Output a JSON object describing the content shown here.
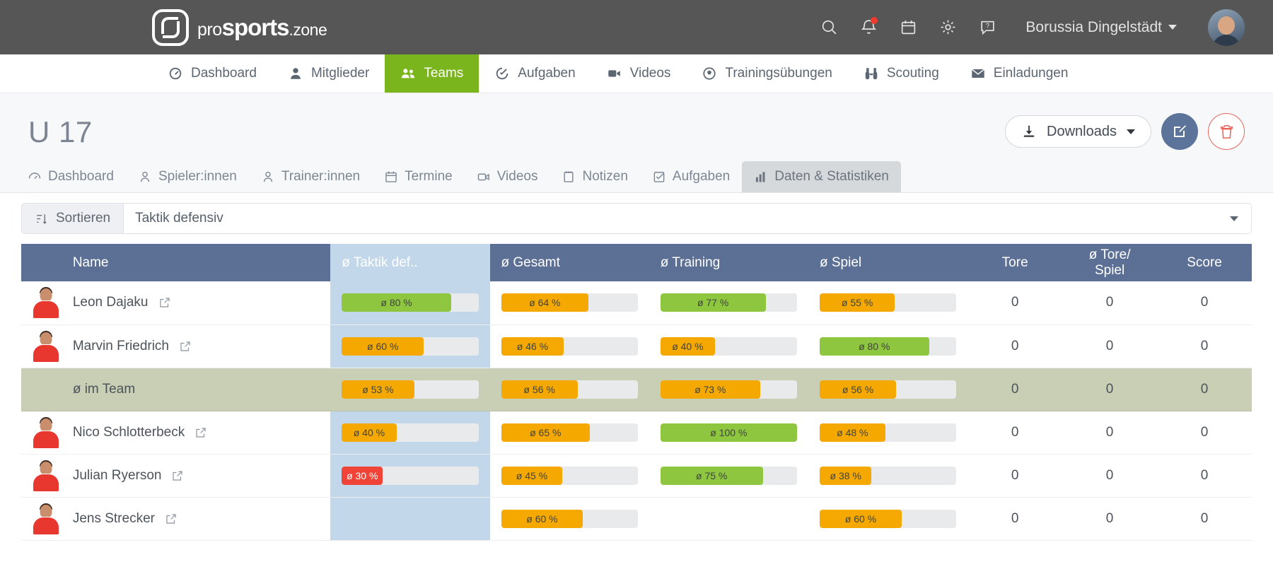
{
  "header": {
    "logo_pro": "pro",
    "logo_sports": "sports",
    "logo_zone": ".zone",
    "icons": [
      "search-icon",
      "bell-icon",
      "calendar-icon",
      "gear-icon",
      "help-icon"
    ],
    "org_name": "Borussia Dingelstädt"
  },
  "mainnav": [
    {
      "label": "Dashboard",
      "icon": "speedometer-icon",
      "active": false
    },
    {
      "label": "Mitglieder",
      "icon": "person-icon",
      "active": false
    },
    {
      "label": "Teams",
      "icon": "people-icon",
      "active": true
    },
    {
      "label": "Aufgaben",
      "icon": "check-circle-icon",
      "active": false
    },
    {
      "label": "Videos",
      "icon": "video-camera-icon",
      "active": false
    },
    {
      "label": "Trainingsübungen",
      "icon": "soccer-ball-icon",
      "active": false
    },
    {
      "label": "Scouting",
      "icon": "binoculars-icon",
      "active": false
    },
    {
      "label": "Einladungen",
      "icon": "envelope-icon",
      "active": false
    }
  ],
  "page": {
    "title": "U 17",
    "downloads_label": "Downloads",
    "edit_icon": "edit-pencil-icon",
    "delete_icon": "trash-icon"
  },
  "subtabs": [
    {
      "label": "Dashboard",
      "icon": "speedometer-icon",
      "active": false
    },
    {
      "label": "Spieler:innen",
      "icon": "person-icon",
      "active": false
    },
    {
      "label": "Trainer:innen",
      "icon": "person-icon",
      "active": false
    },
    {
      "label": "Termine",
      "icon": "calendar-icon",
      "active": false
    },
    {
      "label": "Videos",
      "icon": "video-camera-icon",
      "active": false
    },
    {
      "label": "Notizen",
      "icon": "note-icon",
      "active": false
    },
    {
      "label": "Aufgaben",
      "icon": "check-square-icon",
      "active": false
    },
    {
      "label": "Daten & Statistiken",
      "icon": "bar-chart-icon",
      "active": true
    }
  ],
  "sort": {
    "button_label": "Sortieren",
    "icon": "sort-icon",
    "selected": "Taktik defensiv"
  },
  "table": {
    "columns": [
      "Name",
      "ø Taktik def..",
      "ø Gesamt",
      "ø Training",
      "ø Spiel",
      "Tore",
      "ø Tore/ Spiel",
      "Score"
    ],
    "highlight_column_index": 1,
    "rows": [
      {
        "name": "Leon Dajaku",
        "is_team_avg": false,
        "taktik": {
          "label": "ø 80 %",
          "pct": 80,
          "color": "#8ec63f"
        },
        "gesamt": {
          "label": "ø 64 %",
          "pct": 64,
          "color": "#f5a800"
        },
        "training": {
          "label": "ø 77 %",
          "pct": 77,
          "color": "#8ec63f"
        },
        "spiel": {
          "label": "ø 55 %",
          "pct": 55,
          "color": "#f5a800"
        },
        "tore": "0",
        "tore_spiel": "0",
        "score": "0"
      },
      {
        "name": "Marvin Friedrich",
        "is_team_avg": false,
        "taktik": {
          "label": "ø 60 %",
          "pct": 60,
          "color": "#f5a800"
        },
        "gesamt": {
          "label": "ø 46 %",
          "pct": 46,
          "color": "#f5a800"
        },
        "training": {
          "label": "ø 40 %",
          "pct": 40,
          "color": "#f5a800"
        },
        "spiel": {
          "label": "ø 80 %",
          "pct": 80,
          "color": "#8ec63f"
        },
        "tore": "0",
        "tore_spiel": "0",
        "score": "0"
      },
      {
        "name": "ø im Team",
        "is_team_avg": true,
        "taktik": {
          "label": "ø 53 %",
          "pct": 53,
          "color": "#f5a800"
        },
        "gesamt": {
          "label": "ø 56 %",
          "pct": 56,
          "color": "#f5a800"
        },
        "training": {
          "label": "ø 73 %",
          "pct": 73,
          "color": "#f5a800"
        },
        "spiel": {
          "label": "ø 56 %",
          "pct": 56,
          "color": "#f5a800"
        },
        "tore": "0",
        "tore_spiel": "0",
        "score": "0"
      },
      {
        "name": "Nico Schlotterbeck",
        "is_team_avg": false,
        "taktik": {
          "label": "ø 40 %",
          "pct": 40,
          "color": "#f5a800"
        },
        "gesamt": {
          "label": "ø 65 %",
          "pct": 65,
          "color": "#f5a800"
        },
        "training": {
          "label": "ø 100 %",
          "pct": 100,
          "color": "#8ec63f"
        },
        "spiel": {
          "label": "ø 48 %",
          "pct": 48,
          "color": "#f5a800"
        },
        "tore": "0",
        "tore_spiel": "0",
        "score": "0"
      },
      {
        "name": "Julian Ryerson",
        "is_team_avg": false,
        "taktik": {
          "label": "ø 30 %",
          "pct": 30,
          "color": "#f04438"
        },
        "gesamt": {
          "label": "ø 45 %",
          "pct": 45,
          "color": "#f5a800"
        },
        "training": {
          "label": "ø 75 %",
          "pct": 75,
          "color": "#8ec63f"
        },
        "spiel": {
          "label": "ø 38 %",
          "pct": 38,
          "color": "#f5a800"
        },
        "tore": "0",
        "tore_spiel": "0",
        "score": "0"
      },
      {
        "name": "Jens Strecker",
        "is_team_avg": false,
        "taktik": null,
        "gesamt": {
          "label": "ø 60 %",
          "pct": 60,
          "color": "#f5a800"
        },
        "training": null,
        "spiel": {
          "label": "ø 60 %",
          "pct": 60,
          "color": "#f5a800"
        },
        "tore": "0",
        "tore_spiel": "0",
        "score": "0"
      }
    ]
  },
  "colors": {
    "topbar": "#565656",
    "accent_green": "#7ab51d",
    "header_blue": "#5c7096",
    "highlight_blue": "#c3d7ea",
    "team_row": "#c8cfb4",
    "bar_green": "#8ec63f",
    "bar_orange": "#f5a800",
    "bar_red": "#f04438"
  }
}
